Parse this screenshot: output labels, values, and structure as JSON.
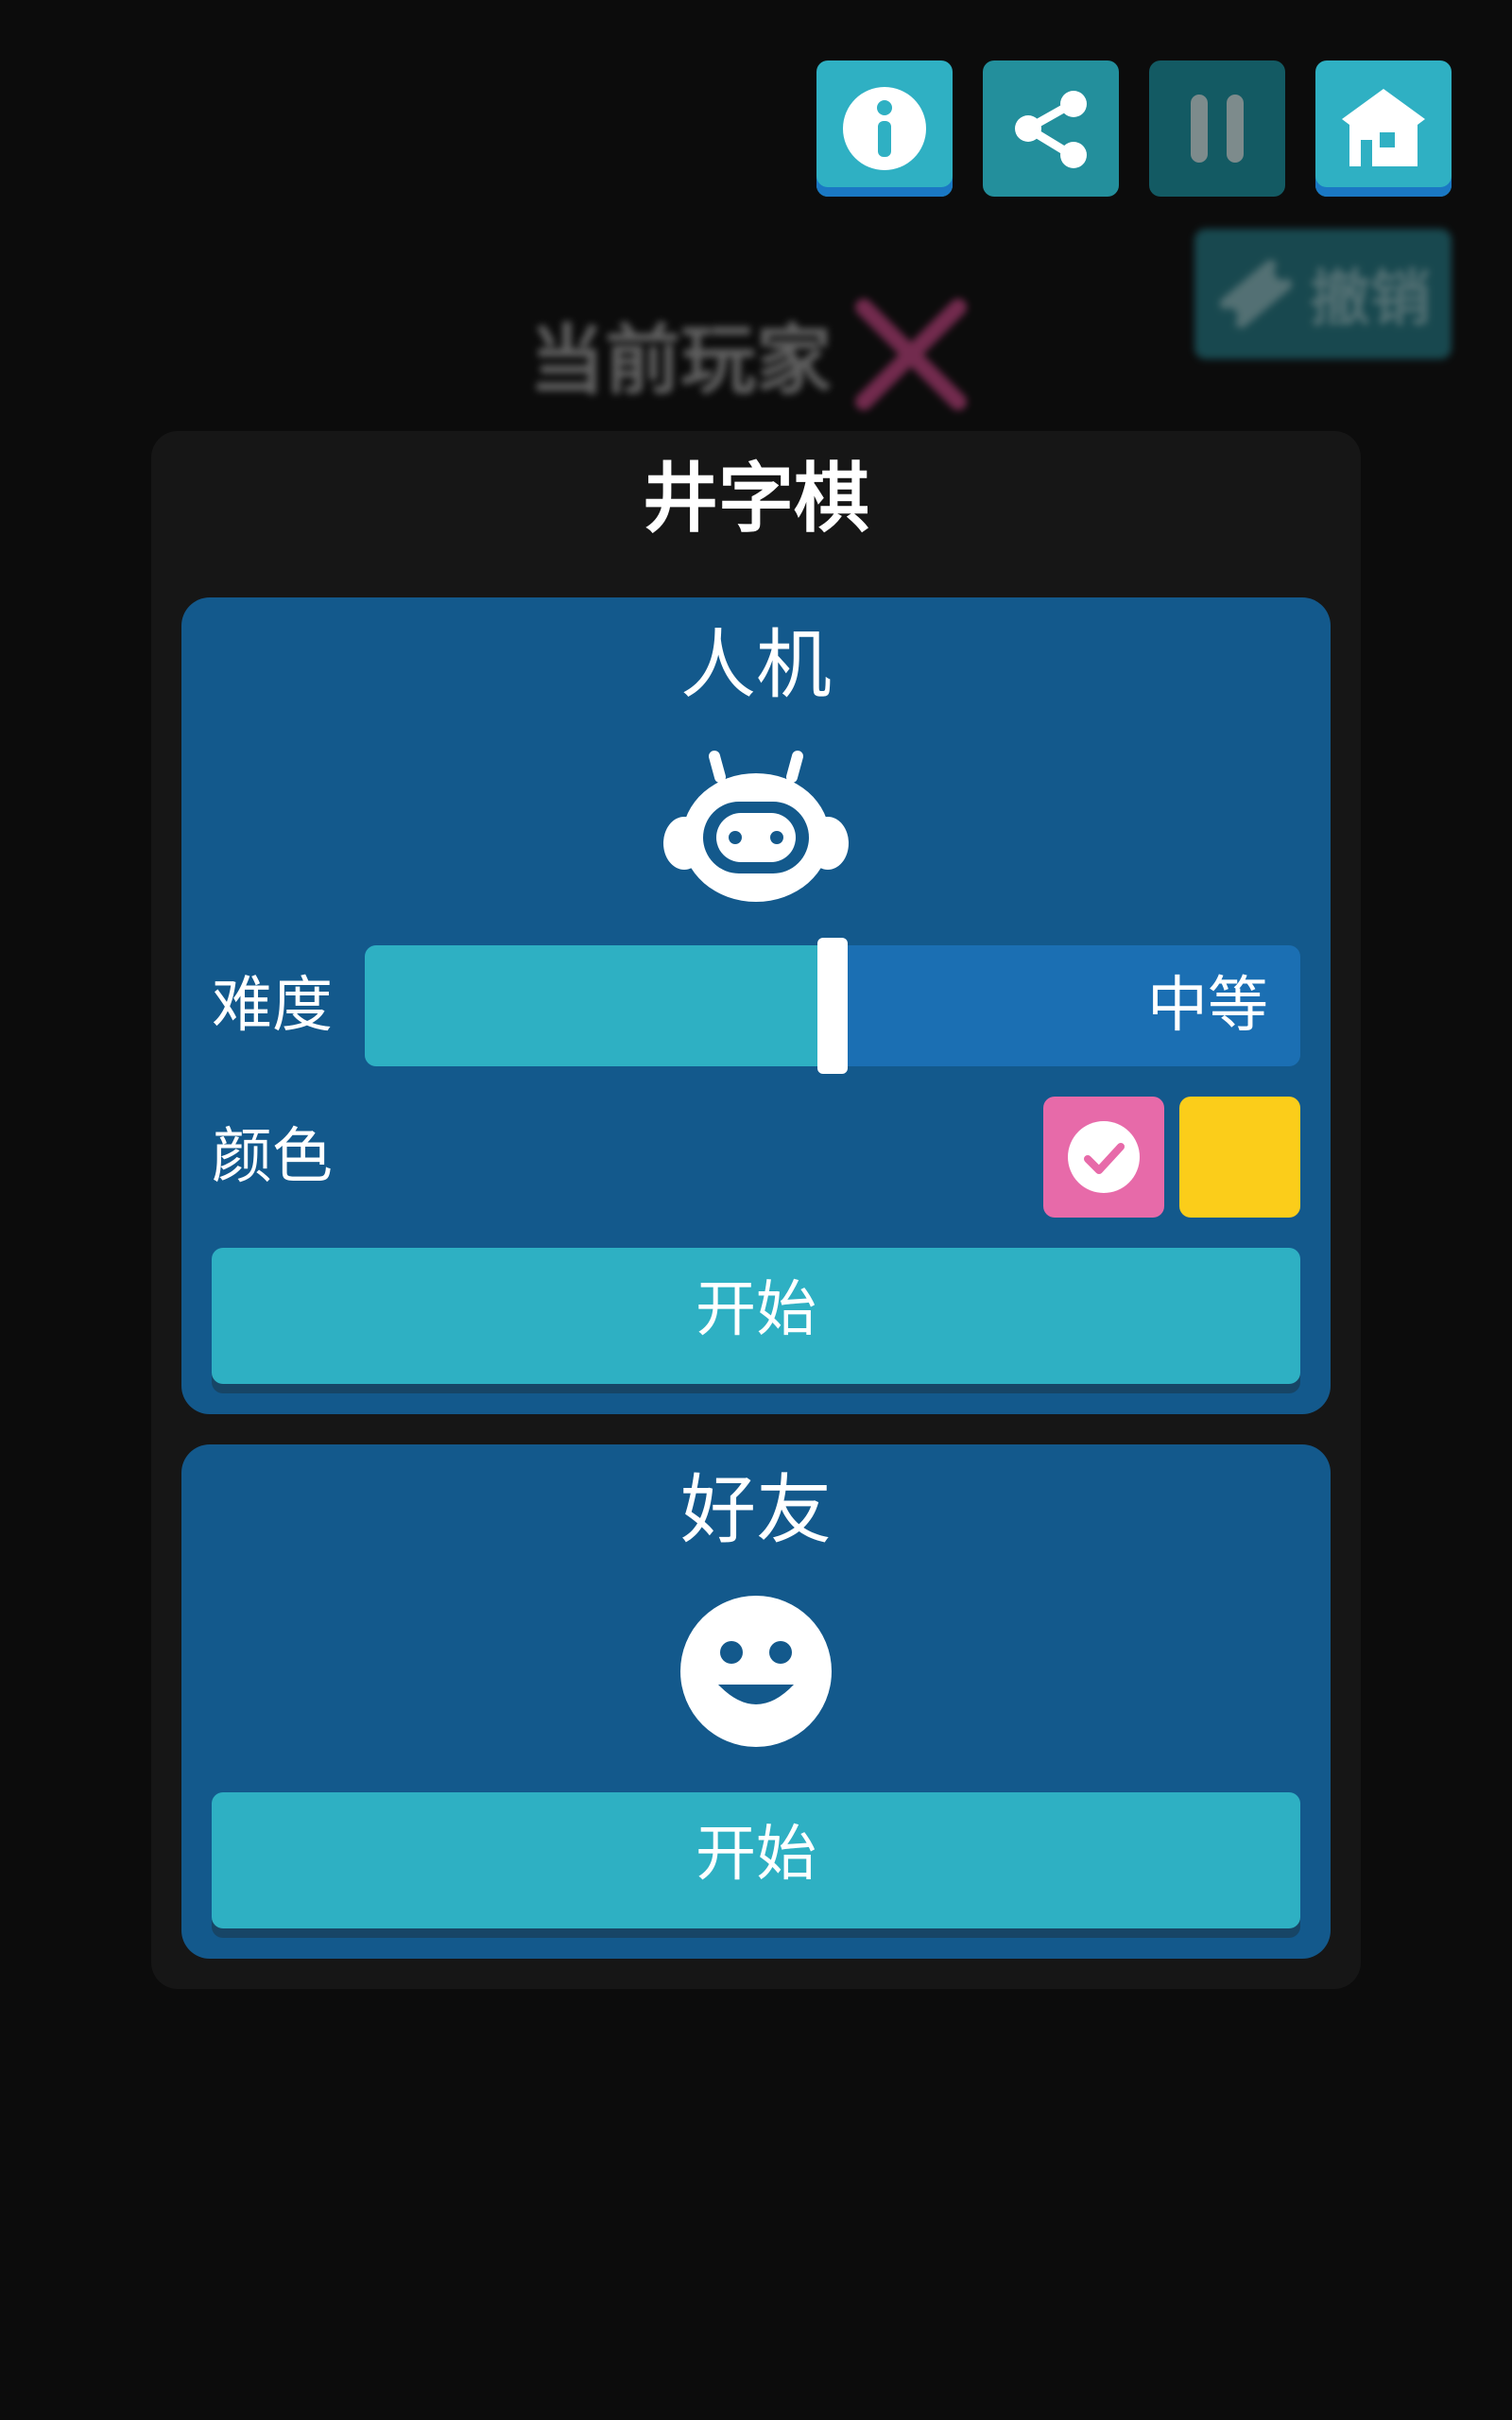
{
  "toolbar": {
    "info_icon": "info-icon",
    "share_icon": "share-icon",
    "pause_icon": "pause-icon",
    "home_icon": "home-icon"
  },
  "background": {
    "undo_label": "撤销",
    "current_player_label": "当前玩家",
    "current_player_mark": "X"
  },
  "panel": {
    "title": "井字棋"
  },
  "ai_mode": {
    "title": "人机",
    "icon": "robot-icon",
    "difficulty_label": "难度",
    "difficulty_value": "中等",
    "difficulty_level_percent": 50,
    "color_label": "颜色",
    "colors": [
      "#e76aa9",
      "#fbcd1a"
    ],
    "selected_color_index": 0,
    "start_label": "开始"
  },
  "friend_mode": {
    "title": "好友",
    "icon": "smiley-icon",
    "start_label": "开始"
  },
  "theme": {
    "background": "#0c0c0c",
    "panel": "#161616",
    "card": "#13598c",
    "accent": "#2eb0c3",
    "slider_track": "#1b6fb3",
    "player_x": "#b7407a"
  }
}
